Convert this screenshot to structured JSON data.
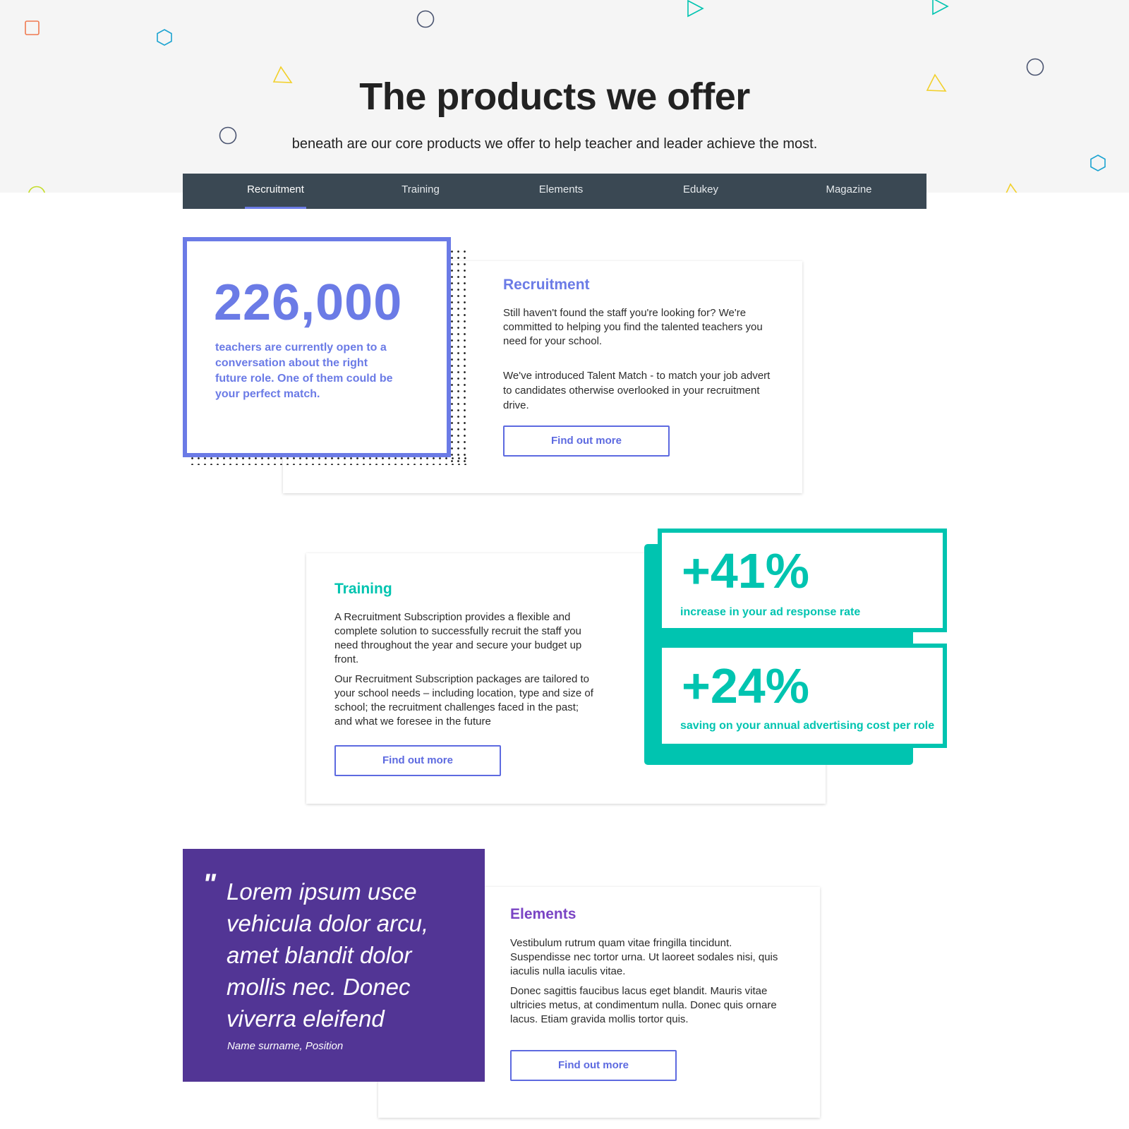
{
  "header": {
    "title": "The products we offer",
    "subtitle": "beneath are our core products we offer to help teacher and leader achieve the most."
  },
  "tabs": [
    {
      "label": "Recruitment",
      "active": true
    },
    {
      "label": "Training",
      "active": false
    },
    {
      "label": "Elements",
      "active": false
    },
    {
      "label": "Edukey",
      "active": false
    },
    {
      "label": "Magazine",
      "active": false
    }
  ],
  "recruitment": {
    "stat_value": "226,000",
    "stat_text": "teachers are currently open to a conversation about the right future role. One of them could be your perfect match.",
    "title": "Recruitment",
    "paragraph1": "Still haven't found the staff you're looking for? We're committed to helping you find the talented teachers you need for your school.",
    "paragraph2": "We've introduced Talent Match - to match your job advert to candidates otherwise overlooked in your recruitment drive.",
    "button": "Find out more"
  },
  "training": {
    "title": "Training",
    "paragraph1": "A Recruitment Subscription provides a flexible and complete solution to successfully recruit the staff you need throughout the year and secure your budget up front.",
    "paragraph2": "Our Recruitment Subscription packages are tailored to your school needs – including location, type and size of school; the recruitment challenges faced in the past; and what we foresee in the future",
    "button": "Find out more",
    "stat1_value": "+41%",
    "stat1_text": "increase in your ad response rate",
    "stat2_value": "+24%",
    "stat2_text": "saving on your annual advertising cost per role"
  },
  "elements": {
    "quote_mark": "\"",
    "quote": "Lorem ipsum usce vehicula dolor arcu, amet blandit dolor mollis nec. Donec viverra eleifend",
    "quote_author": "Name surname, Position",
    "title": "Elements",
    "paragraph1": "Vestibulum rutrum quam vitae fringilla tincidunt. Suspendisse nec tortor urna. Ut laoreet sodales nisi, quis iaculis nulla iaculis vitae.",
    "paragraph2": "Donec sagittis faucibus lacus eget blandit. Mauris vitae ultricies metus, at condimentum nulla. Donec quis ornare lacus. Etiam gravida mollis tortor quis.",
    "button": "Find out more"
  },
  "colors": {
    "recruitment_accent": "#6b7be6",
    "training_accent": "#00c4b0",
    "elements_accent": "#7a44c4",
    "quote_bg": "#523595",
    "tabbar_bg": "#3a4853",
    "button_border": "#5d6ae0"
  }
}
